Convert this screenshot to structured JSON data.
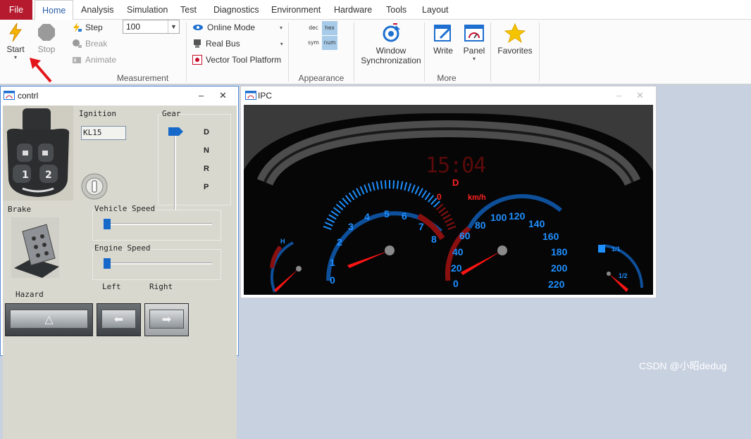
{
  "menu": {
    "file": "File",
    "home": "Home",
    "analysis": "Analysis",
    "simulation": "Simulation",
    "test": "Test",
    "diagnostics": "Diagnostics",
    "environment": "Environment",
    "hardware": "Hardware",
    "tools": "Tools",
    "layout": "Layout"
  },
  "ribbon": {
    "start": "Start",
    "stop": "Stop",
    "step": "Step",
    "break": "Break",
    "animate": "Animate",
    "speed_value": "100",
    "measurement_group": "Measurement",
    "online_mode": "Online Mode",
    "real_bus": "Real Bus",
    "vector_tool_platform": "Vector Tool Platform",
    "dec": "dec",
    "hex": "hex",
    "sym": "sym",
    "num": "num",
    "appearance_group": "Appearance",
    "window_sync_1": "Window",
    "window_sync_2": "Synchronization",
    "write": "Write",
    "panel": "Panel",
    "more_group": "More",
    "favorites": "Favorites"
  },
  "contrl_window": {
    "title": "contrl",
    "minimize": "–",
    "close": "✕",
    "ignition_label": "Ignition",
    "ignition_value": "KL15",
    "gear_label": "Gear",
    "gears": [
      "D",
      "N",
      "R",
      "P"
    ],
    "brake_label": "Brake",
    "vehicle_speed_label": "Vehicle Speed",
    "engine_speed_label": "Engine Speed",
    "hazard_label": "Hazard",
    "left_label": "Left",
    "right_label": "Right",
    "vehicle_speed": 0,
    "engine_speed": 0
  },
  "ipc_window": {
    "title": "IPC",
    "minimize": "–",
    "close": "✕",
    "clock": "15:04",
    "gear": "D",
    "speed": "0",
    "speed_unit": "km/h",
    "rpm_ticks": [
      "0",
      "1",
      "2",
      "3",
      "4",
      "5",
      "6",
      "7",
      "8"
    ],
    "speed_ticks": [
      "0",
      "20",
      "40",
      "60",
      "80",
      "100",
      "120",
      "140",
      "160",
      "180",
      "200",
      "220"
    ],
    "temp_h": "H",
    "fuel_half": "1/2",
    "fuel_label": "1/1"
  },
  "watermark": "CSDN @小昭dedug",
  "colors": {
    "file_red": "#b51a2e",
    "accent_blue": "#2a5fa8",
    "gauge_blue": "#1e8fff",
    "needle_red": "#ff1414"
  }
}
